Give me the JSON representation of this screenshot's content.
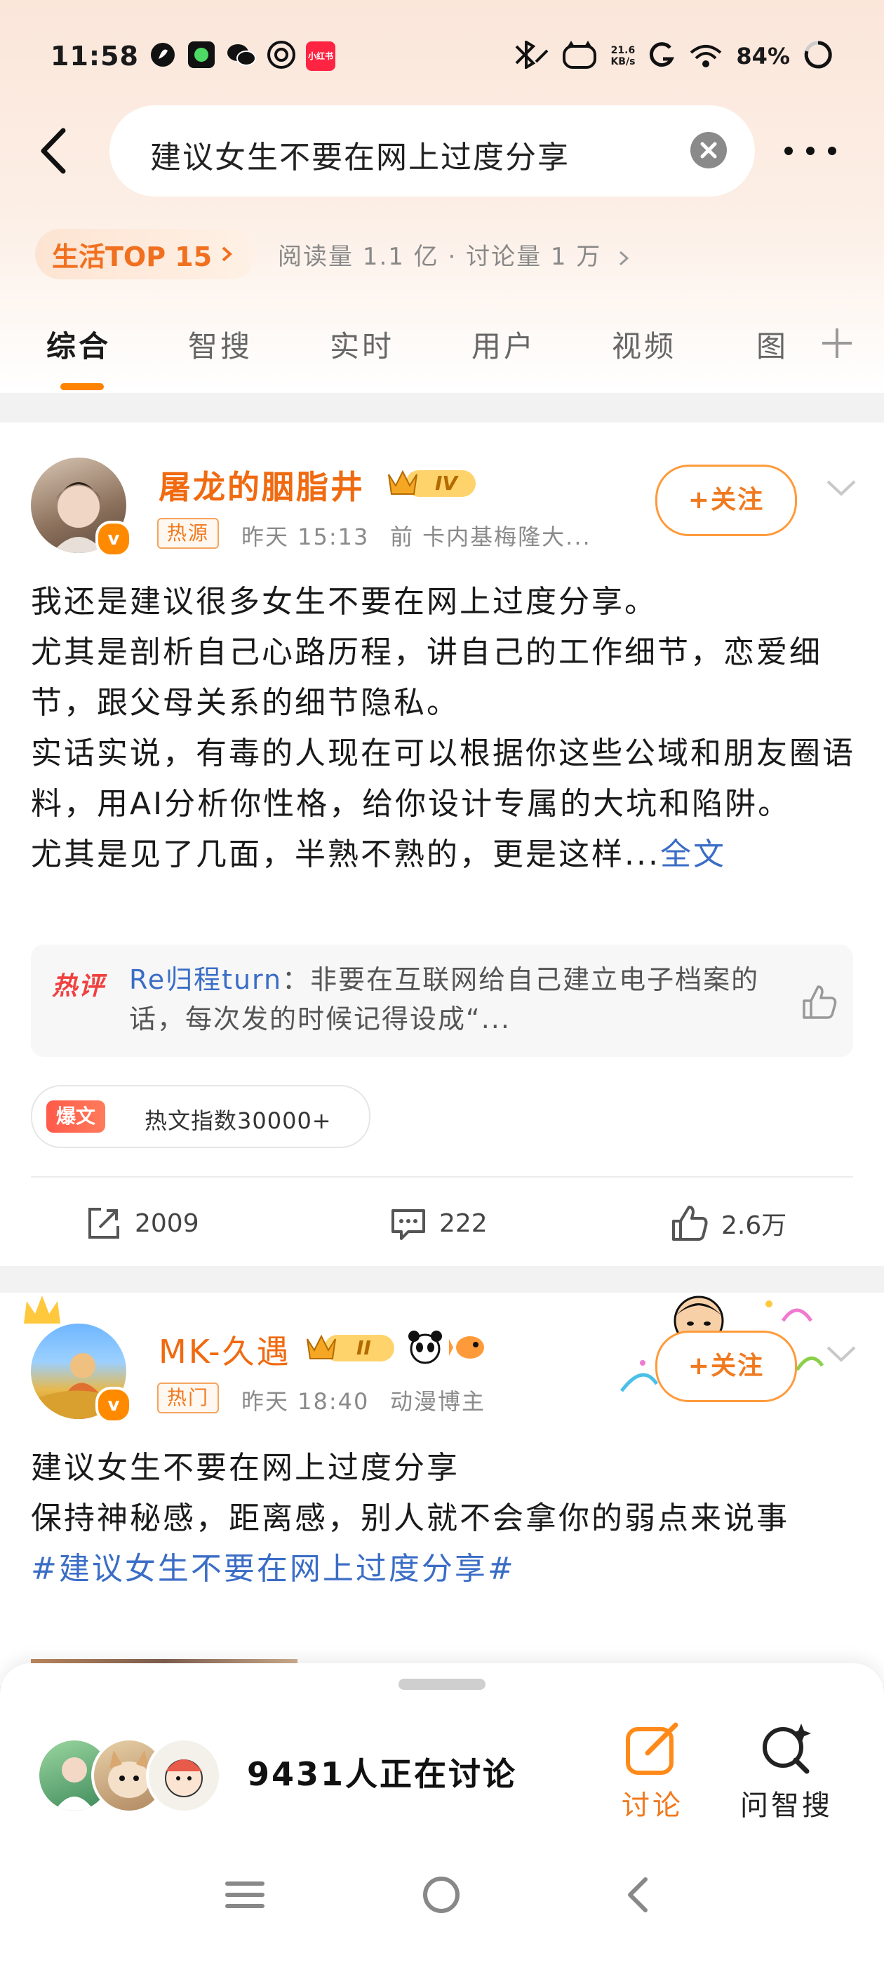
{
  "status_bar": {
    "time": "11:58",
    "net_speed_value": "21.6",
    "net_speed_unit": "KB/s",
    "battery": "84%",
    "app_badge": "小红书"
  },
  "search": {
    "query": "建议女生不要在网上过度分享"
  },
  "topic": {
    "rank_badge": "生活TOP 15",
    "stats": "阅读量 1.1 亿 · 讨论量 1 万"
  },
  "tabs": [
    {
      "label": "综合"
    },
    {
      "label": "智搜"
    },
    {
      "label": "实时"
    },
    {
      "label": "用户"
    },
    {
      "label": "视频"
    },
    {
      "label": "图"
    }
  ],
  "posts": [
    {
      "username": "屠龙的胭脂井",
      "level": "IV",
      "tag": "热源",
      "time": "昨天 15:13",
      "meta": "前 卡内基梅隆大...",
      "follow_label": "+关注",
      "lines": [
        "我还是建议很多女生不要在网上过度分享。",
        "尤其是剖析自己心路历程，讲自己的工作细节，恋爱细节，跟父母关系的细节隐私。",
        "实话实说，有毒的人现在可以根据你这些公域和朋友圈语料，用AI分析你性格，给你设计专属的大坑和陷阱。",
        "尤其是见了几面，半熟不熟的，更是这样..."
      ],
      "more_link": "全文",
      "hot_comment": {
        "label": "热评",
        "user": "Re归程turn",
        "text": "：非要在互联网给自己建立电子档案的话，每次发的时候记得设成“..."
      },
      "hot_badge": "爆文",
      "hot_index": "热文指数30000+",
      "shares": "2009",
      "comments": "222",
      "likes": "2.6万"
    },
    {
      "username": "MK-久遇",
      "level": "II",
      "tag": "热门",
      "time": "昨天 18:40",
      "meta": "动漫博主",
      "follow_label": "+关注",
      "lines": [
        "建议女生不要在网上过度分享",
        "保持神秘感，距离感，别人就不会拿你的弱点来说事"
      ],
      "hashtag": "#建议女生不要在网上过度分享#"
    }
  ],
  "discussion": {
    "count_text": "9431人正在讨论",
    "discuss_label": "讨论",
    "ask_label": "问智搜"
  },
  "colors": {
    "accent": "#ff8200",
    "username": "#f06a10",
    "link": "#3b6dc6"
  }
}
